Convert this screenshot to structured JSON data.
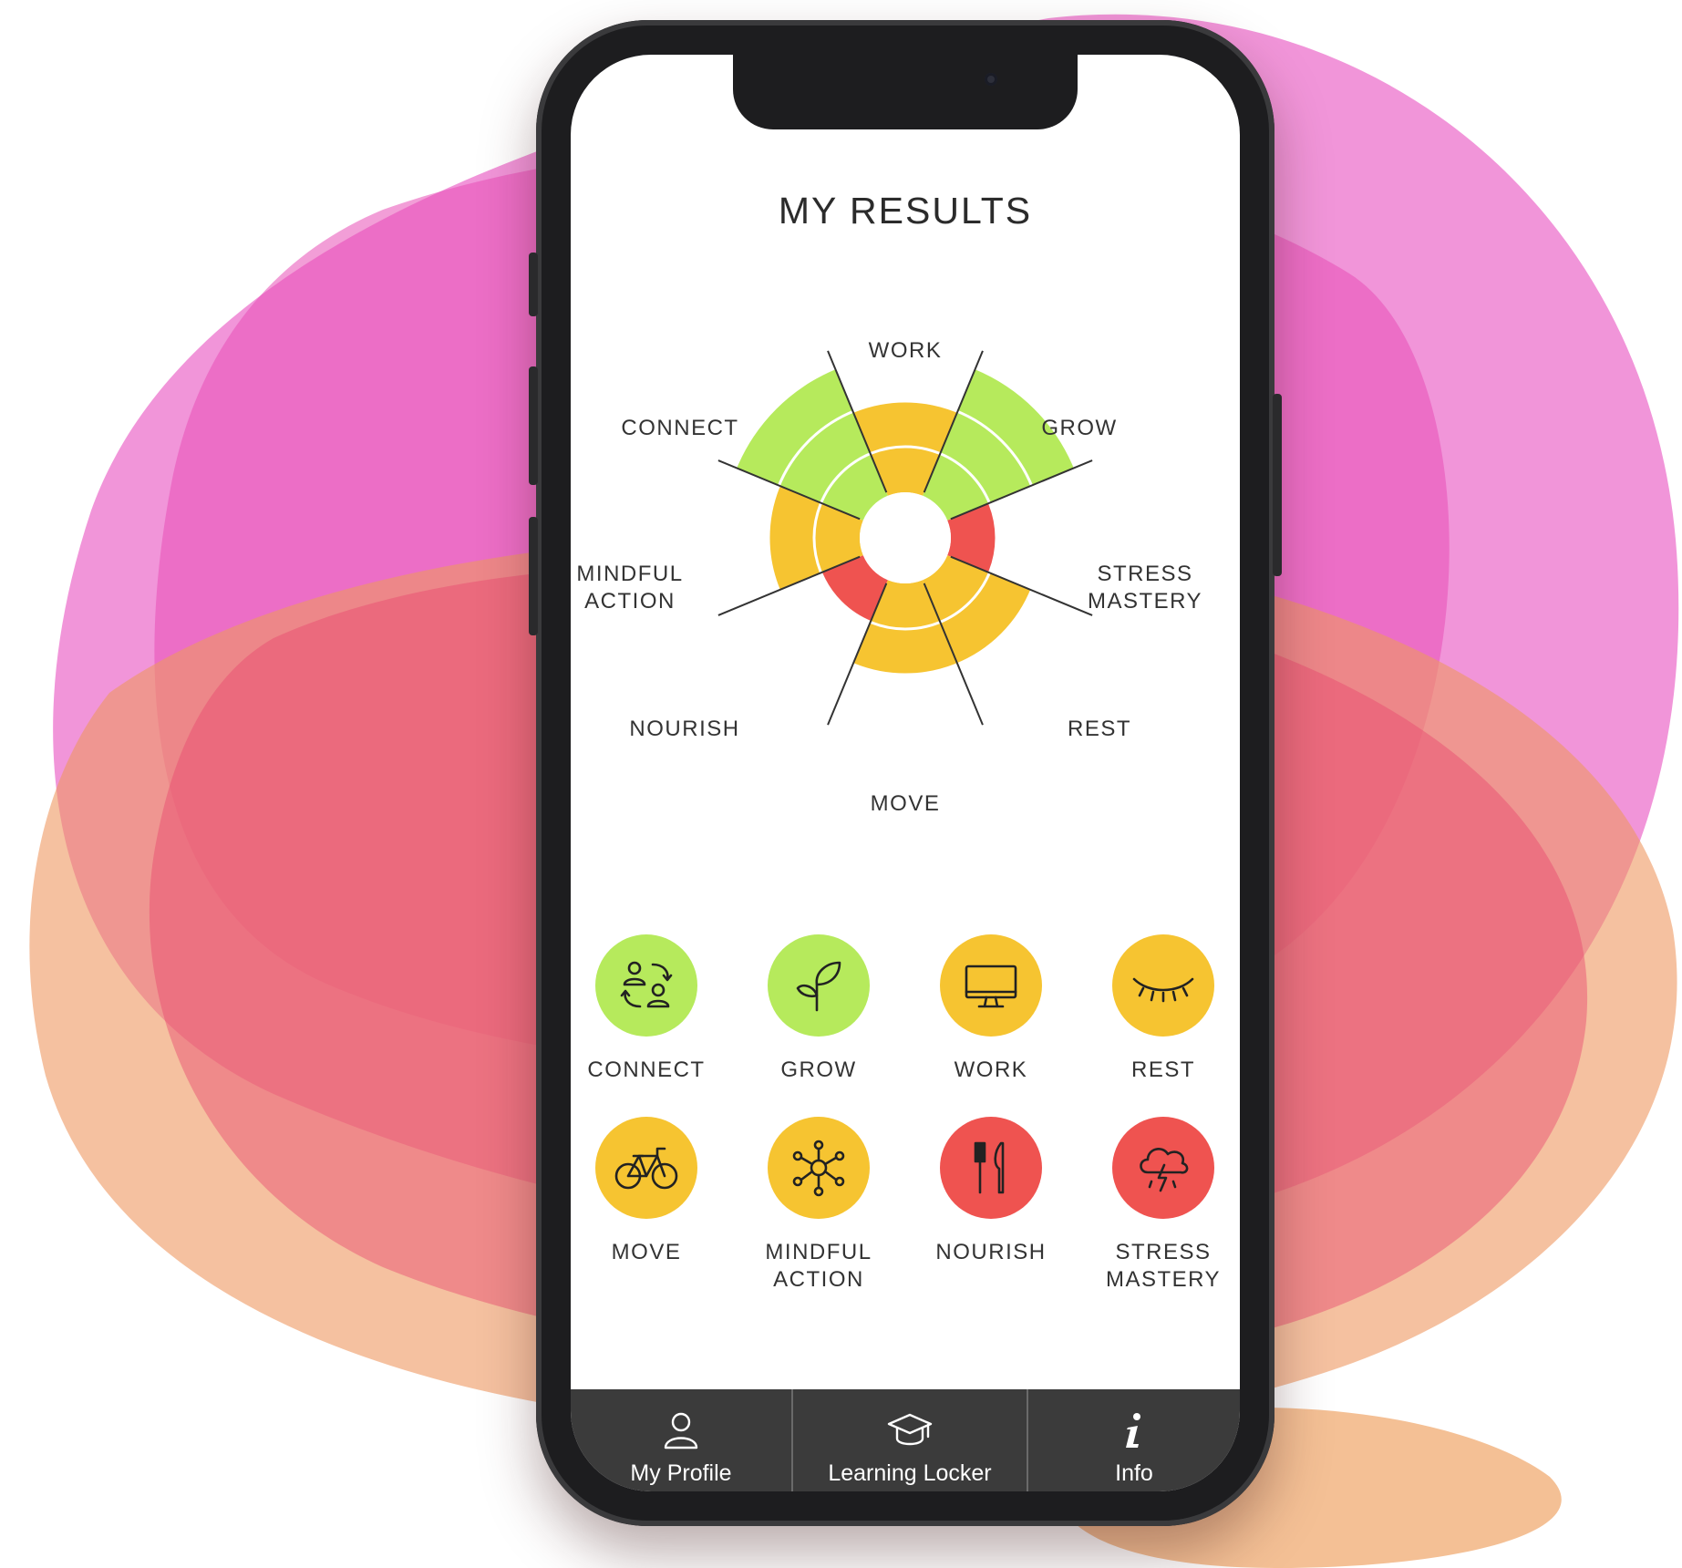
{
  "screen": {
    "title": "MY RESULTS"
  },
  "colors": {
    "green": "#b6ea5c",
    "yellow": "#f6c431",
    "red": "#ef5350",
    "tabbar": "#3b3b3b"
  },
  "wheel": {
    "labels": {
      "work": "WORK",
      "grow": "GROW",
      "stress_mastery": "STRESS\nMASTERY",
      "rest": "REST",
      "move": "MOVE",
      "nourish": "NOURISH",
      "mindful_action": "MINDFUL\nACTION",
      "connect": "CONNECT"
    },
    "segments": [
      {
        "key": "work",
        "level": 2,
        "status": "yellow"
      },
      {
        "key": "grow",
        "level": 3,
        "status": "green"
      },
      {
        "key": "stress_mastery",
        "level": 1,
        "status": "red"
      },
      {
        "key": "rest",
        "level": 2,
        "status": "yellow"
      },
      {
        "key": "move",
        "level": 2,
        "status": "yellow"
      },
      {
        "key": "nourish",
        "level": 1,
        "status": "red"
      },
      {
        "key": "mindful_action",
        "level": 2,
        "status": "yellow"
      },
      {
        "key": "connect",
        "level": 3,
        "status": "green"
      }
    ]
  },
  "categories": [
    {
      "label": "CONNECT",
      "icon": "connect-people-icon",
      "status": "green"
    },
    {
      "label": "GROW",
      "icon": "sprout-icon",
      "status": "green"
    },
    {
      "label": "WORK",
      "icon": "monitor-icon",
      "status": "yellow"
    },
    {
      "label": "REST",
      "icon": "closed-eye-icon",
      "status": "yellow"
    },
    {
      "label": "MOVE",
      "icon": "bicycle-icon",
      "status": "yellow"
    },
    {
      "label": "MINDFUL\nACTION",
      "icon": "network-icon",
      "status": "yellow"
    },
    {
      "label": "NOURISH",
      "icon": "cutlery-icon",
      "status": "red"
    },
    {
      "label": "STRESS\nMASTERY",
      "icon": "storm-cloud-icon",
      "status": "red"
    }
  ],
  "tabbar": {
    "items": [
      {
        "label": "My Profile",
        "icon": "user-icon"
      },
      {
        "label": "Learning Locker",
        "icon": "graduation-cap-icon"
      },
      {
        "label": "Info",
        "icon": "info-icon"
      }
    ]
  }
}
